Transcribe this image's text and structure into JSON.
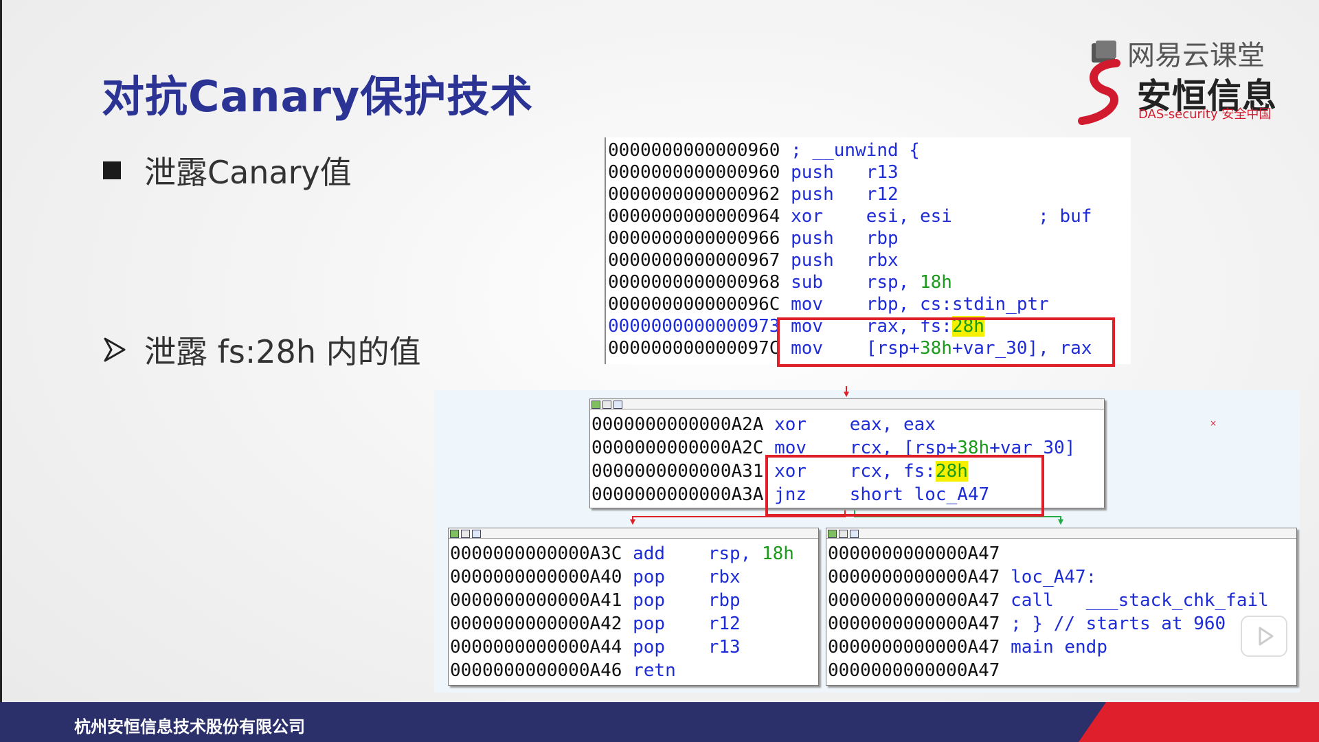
{
  "slide": {
    "title": "对抗Canary保护技术",
    "bullet1": "泄露Canary值",
    "bullet2": "泄露 fs:28h 内的值",
    "footer": "杭州安恒信息技术股份有限公司"
  },
  "logo": {
    "platform": "网易云课堂",
    "company": "安恒信息",
    "sub": "DAS-security 安全中国"
  },
  "colors": {
    "title": "#2b3494",
    "footer_bg": "#2b2f6a",
    "footer_accent": "#e01f2c",
    "highlight_box": "#e02028",
    "highlight_fill": "#f4f000"
  },
  "top_listing": [
    {
      "addr": "0000000000000960",
      "mn": "; __unwind {",
      "op": "",
      "num": "",
      "cmt": ""
    },
    {
      "addr": "0000000000000960",
      "mn": "push",
      "op": "r13",
      "num": "",
      "cmt": ""
    },
    {
      "addr": "0000000000000962",
      "mn": "push",
      "op": "r12",
      "num": "",
      "cmt": ""
    },
    {
      "addr": "0000000000000964",
      "mn": "xor",
      "op": "esi, esi",
      "num": "",
      "cmt": "; buf"
    },
    {
      "addr": "0000000000000966",
      "mn": "push",
      "op": "rbp",
      "num": "",
      "cmt": ""
    },
    {
      "addr": "0000000000000967",
      "mn": "push",
      "op": "rbx",
      "num": "",
      "cmt": ""
    },
    {
      "addr": "0000000000000968",
      "mn": "sub",
      "op": "rsp, ",
      "num": "18h",
      "cmt": ""
    },
    {
      "addr": "000000000000096C",
      "mn": "mov",
      "op": "rbp, cs:stdin_ptr",
      "num": "",
      "cmt": ""
    },
    {
      "addr": "0000000000000973",
      "mn": "mov",
      "op": "rax, fs:",
      "num": "28h",
      "cmt": ""
    },
    {
      "addr": "000000000000097C",
      "mn": "mov",
      "op": "[rsp+",
      "num": "38h",
      "op2": "+var_30], rax",
      "cmt": ""
    }
  ],
  "node_check": [
    {
      "addr": "0000000000000A2A",
      "mn": "xor",
      "op": "eax, eax"
    },
    {
      "addr": "0000000000000A2C",
      "mn": "mov",
      "op": "rcx, [rsp+",
      "num": "38h",
      "op2": "+var_30]"
    },
    {
      "addr": "0000000000000A31",
      "mn": "xor",
      "op": "rcx, fs:",
      "num": "28h"
    },
    {
      "addr": "0000000000000A3A",
      "mn": "jnz",
      "op": "short loc_A47"
    }
  ],
  "node_ok": [
    {
      "addr": "0000000000000A3C",
      "mn": "add",
      "op": "rsp, ",
      "num": "18h"
    },
    {
      "addr": "0000000000000A40",
      "mn": "pop",
      "op": "rbx"
    },
    {
      "addr": "0000000000000A41",
      "mn": "pop",
      "op": "rbp"
    },
    {
      "addr": "0000000000000A42",
      "mn": "pop",
      "op": "r12"
    },
    {
      "addr": "0000000000000A44",
      "mn": "pop",
      "op": "r13"
    },
    {
      "addr": "0000000000000A46",
      "mn": "retn",
      "op": ""
    }
  ],
  "node_fail": [
    {
      "addr": "0000000000000A47",
      "mn": "",
      "op": ""
    },
    {
      "addr": "0000000000000A47",
      "mn": "loc_A47:",
      "op": ""
    },
    {
      "addr": "0000000000000A47",
      "mn": "call",
      "op": "___stack_chk_fail"
    },
    {
      "addr": "0000000000000A47",
      "mn": "; } // starts at 960",
      "op": ""
    },
    {
      "addr": "0000000000000A47",
      "mn": "main endp",
      "op": ""
    },
    {
      "addr": "0000000000000A47",
      "mn": "",
      "op": ""
    }
  ]
}
